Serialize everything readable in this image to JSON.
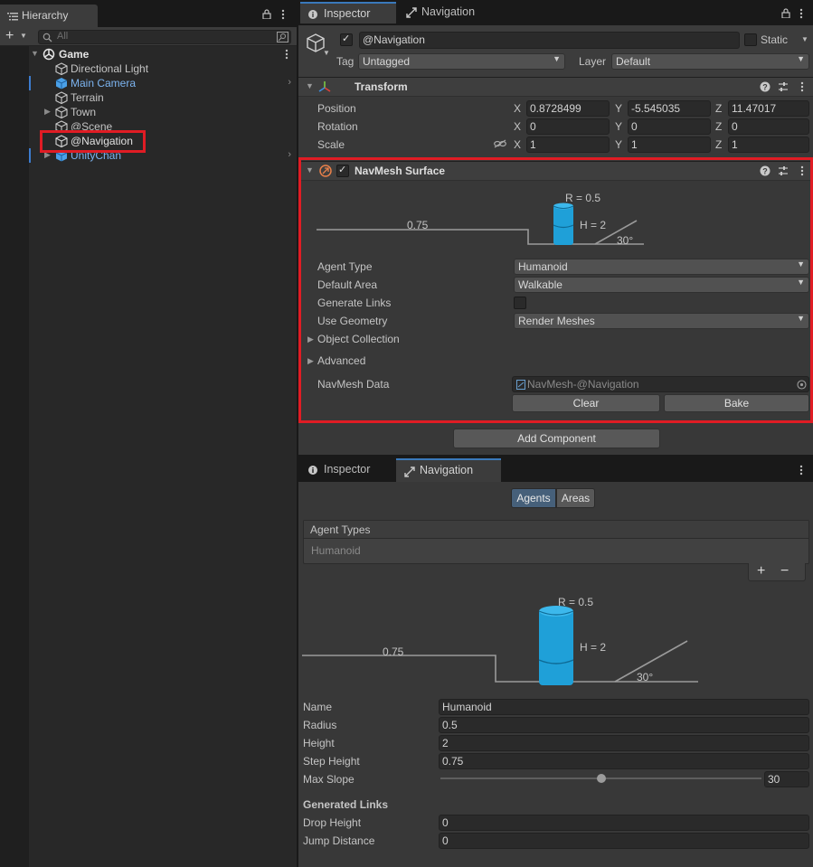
{
  "hierarchy": {
    "tab_label": "Hierarchy",
    "search_placeholder": "All",
    "scene": "Game",
    "items": [
      {
        "label": "Directional Light"
      },
      {
        "label": "Main Camera"
      },
      {
        "label": "Terrain"
      },
      {
        "label": "Town"
      },
      {
        "label": "@Scene"
      },
      {
        "label": "@Navigation"
      },
      {
        "label": "UnityChan"
      }
    ]
  },
  "inspector": {
    "tabs": [
      "Inspector",
      "Navigation"
    ],
    "object_name": "@Navigation",
    "static_label": "Static",
    "tag_label": "Tag",
    "tag_value": "Untagged",
    "layer_label": "Layer",
    "layer_value": "Default",
    "transform": {
      "title": "Transform",
      "rows": [
        {
          "label": "Position",
          "x": "0.8728499",
          "y": "-5.545035",
          "z": "11.47017"
        },
        {
          "label": "Rotation",
          "x": "0",
          "y": "0",
          "z": "0"
        },
        {
          "label": "Scale",
          "x": "1",
          "y": "1",
          "z": "1"
        }
      ],
      "axes": [
        "X",
        "Y",
        "Z"
      ]
    },
    "navmesh_surface": {
      "title": "NavMesh Surface",
      "diagram": {
        "radius": "R = 0.5",
        "height": "H = 2",
        "step": "0.75",
        "slope": "30°"
      },
      "agent_type_label": "Agent Type",
      "agent_type_value": "Humanoid",
      "default_area_label": "Default Area",
      "default_area_value": "Walkable",
      "generate_links_label": "Generate Links",
      "use_geometry_label": "Use Geometry",
      "use_geometry_value": "Render Meshes",
      "object_collection_label": "Object Collection",
      "advanced_label": "Advanced",
      "navmesh_data_label": "NavMesh Data",
      "navmesh_data_value": "NavMesh-@Navigation",
      "clear_label": "Clear",
      "bake_label": "Bake"
    },
    "add_component_label": "Add Component"
  },
  "navigation": {
    "tabs": [
      "Inspector",
      "Navigation"
    ],
    "segments": [
      "Agents",
      "Areas"
    ],
    "agent_types_header": "Agent Types",
    "agent_types": [
      "Humanoid"
    ],
    "plus": "+",
    "minus": "−",
    "diagram": {
      "radius": "R = 0.5",
      "height": "H = 2",
      "step": "0.75",
      "slope": "30°"
    },
    "fields": [
      {
        "label": "Name",
        "value": "Humanoid"
      },
      {
        "label": "Radius",
        "value": "0.5"
      },
      {
        "label": "Height",
        "value": "2"
      },
      {
        "label": "Step Height",
        "value": "0.75"
      }
    ],
    "max_slope_label": "Max Slope",
    "max_slope_value": "30",
    "max_slope_fraction": 0.5,
    "generated_links_label": "Generated Links",
    "drop_height_label": "Drop Height",
    "drop_height_value": "0",
    "jump_distance_label": "Jump Distance",
    "jump_distance_value": "0"
  }
}
